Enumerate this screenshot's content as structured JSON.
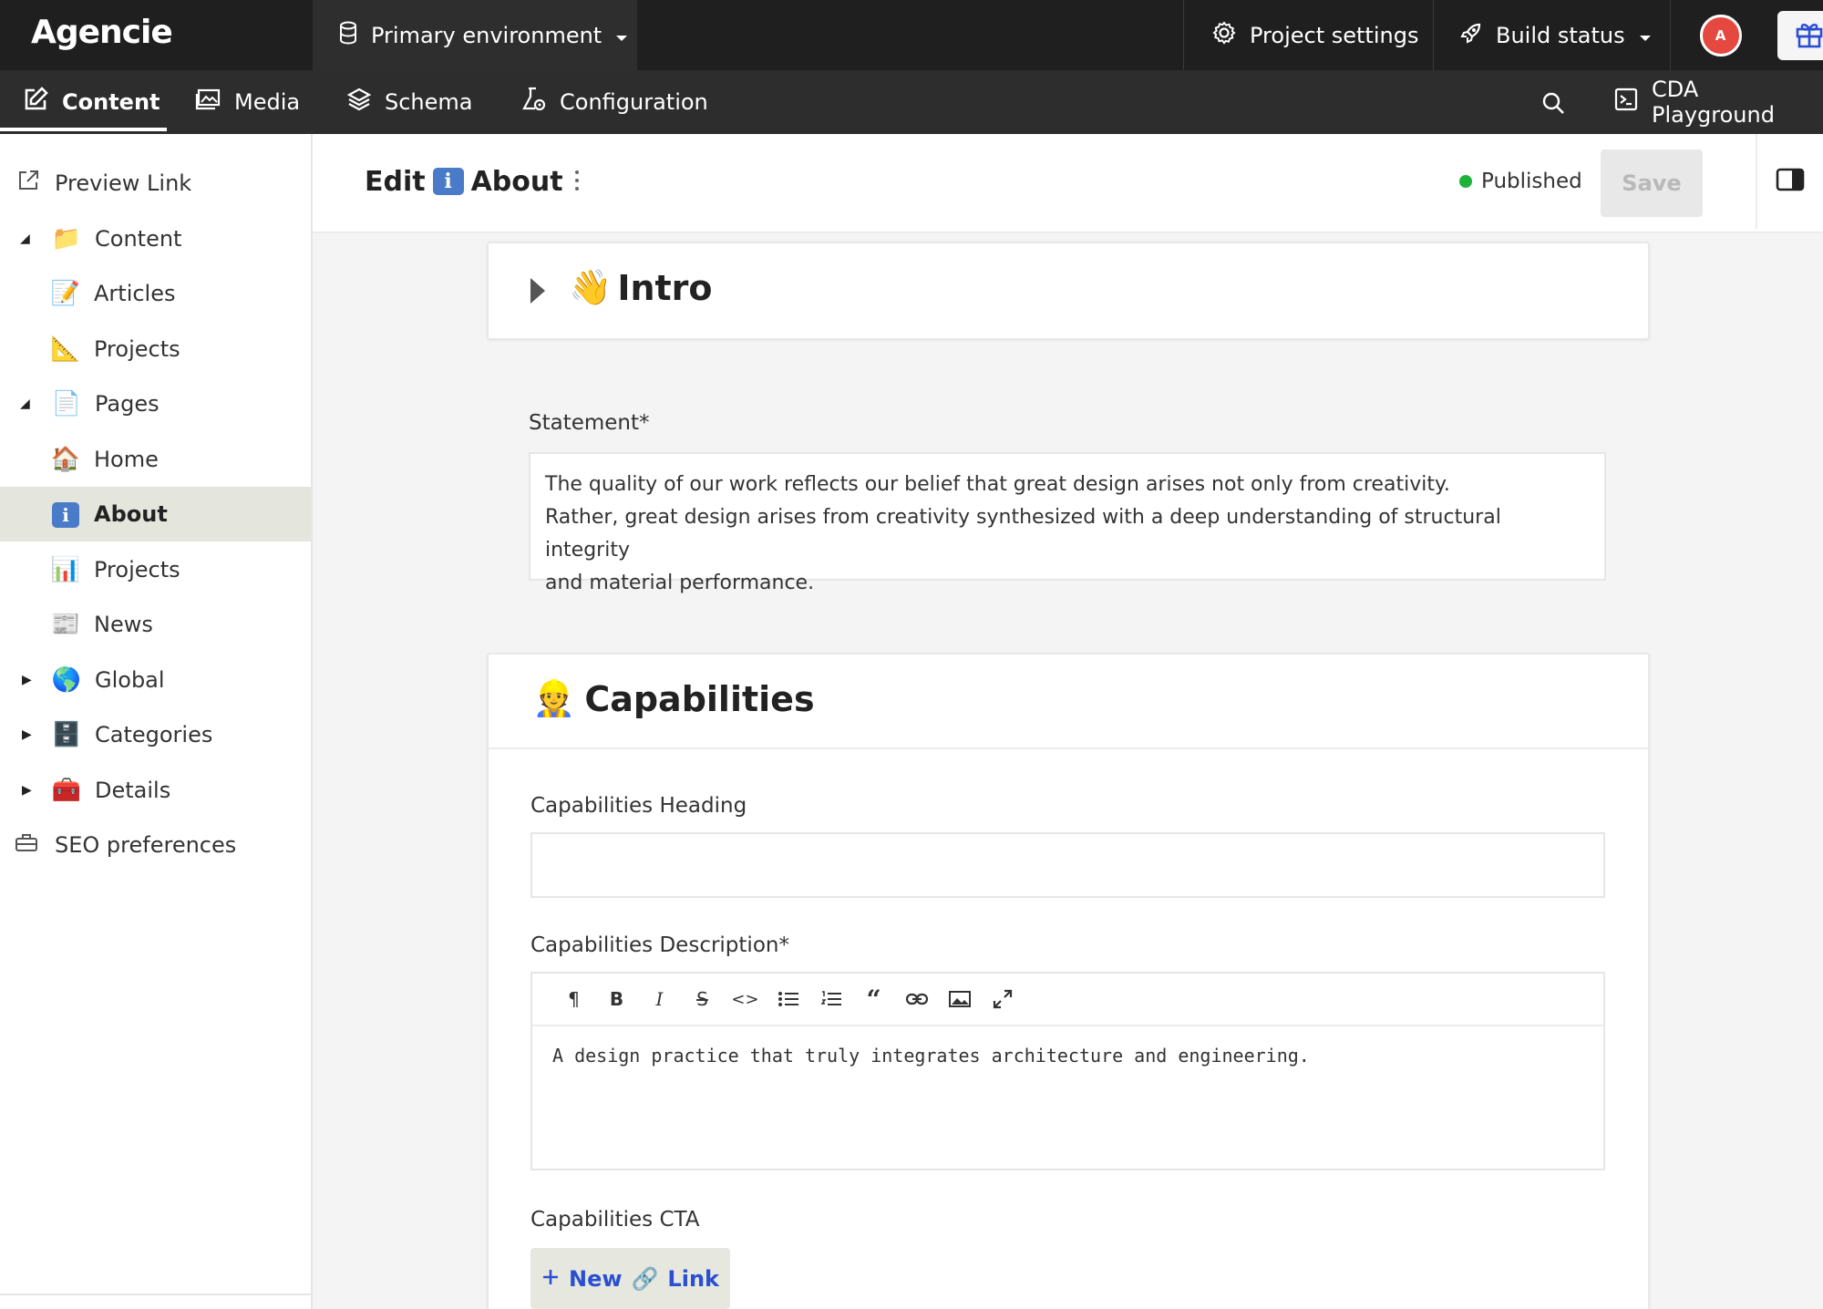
{
  "topbar": {
    "logo": "Agencie",
    "environment": "Primary environment",
    "project_settings": "Project settings",
    "build_status": "Build status",
    "avatar_initial": "A"
  },
  "nav": {
    "tabs": [
      {
        "label": "Content",
        "icon": "edit-icon",
        "active": true
      },
      {
        "label": "Media",
        "icon": "image-icon",
        "active": false
      },
      {
        "label": "Schema",
        "icon": "layers-icon",
        "active": false
      },
      {
        "label": "Configuration",
        "icon": "flask-gear-icon",
        "active": false
      }
    ],
    "cda_playground": "CDA Playground"
  },
  "sidebar": {
    "items": [
      {
        "label": "Preview Link",
        "icon": "external-link-icon"
      },
      {
        "label": "Content",
        "emoji": "📁"
      },
      {
        "label": "Articles",
        "emoji": "📝"
      },
      {
        "label": "Projects",
        "emoji": "📐"
      },
      {
        "label": "Pages",
        "emoji": "📄"
      },
      {
        "label": "Home",
        "emoji": "🏠"
      },
      {
        "label": "About",
        "emoji": "ℹ️"
      },
      {
        "label": "Projects",
        "emoji": "📊"
      },
      {
        "label": "News",
        "emoji": "📰"
      },
      {
        "label": "Global",
        "emoji": "🌎"
      },
      {
        "label": "Categories",
        "emoji": "🗄️"
      },
      {
        "label": "Details",
        "emoji": "🧰"
      },
      {
        "label": "SEO preferences",
        "icon": "toolbox-icon"
      }
    ]
  },
  "header": {
    "edit_prefix": "Edit",
    "info_badge": "i",
    "record_title": "About",
    "status": "Published",
    "save_label": "Save",
    "status_color": "#1db33a"
  },
  "intro": {
    "emoji": "👋",
    "title": "Intro"
  },
  "statement": {
    "label": "Statement*",
    "line1": "The quality of our work reflects our belief that great design arises not only from creativity.",
    "line2": "Rather, great design arises from creativity synthesized with a deep understanding of structural integrity",
    "line3": "and material performance."
  },
  "capabilities": {
    "emoji": "👷",
    "title": "Capabilities",
    "heading_label": "Capabilities Heading",
    "heading_value": "",
    "description_label": "Capabilities Description*",
    "description_value": "A design practice that truly integrates architecture and engineering.",
    "cta_label": "Capabilities CTA",
    "new_link_prefix": "New",
    "new_link_emoji": "🔗",
    "new_link_suffix": "Link"
  },
  "toolbar": {
    "paragraph": "¶",
    "bold": "B",
    "italic": "I",
    "strike": "S",
    "code": "<>"
  }
}
